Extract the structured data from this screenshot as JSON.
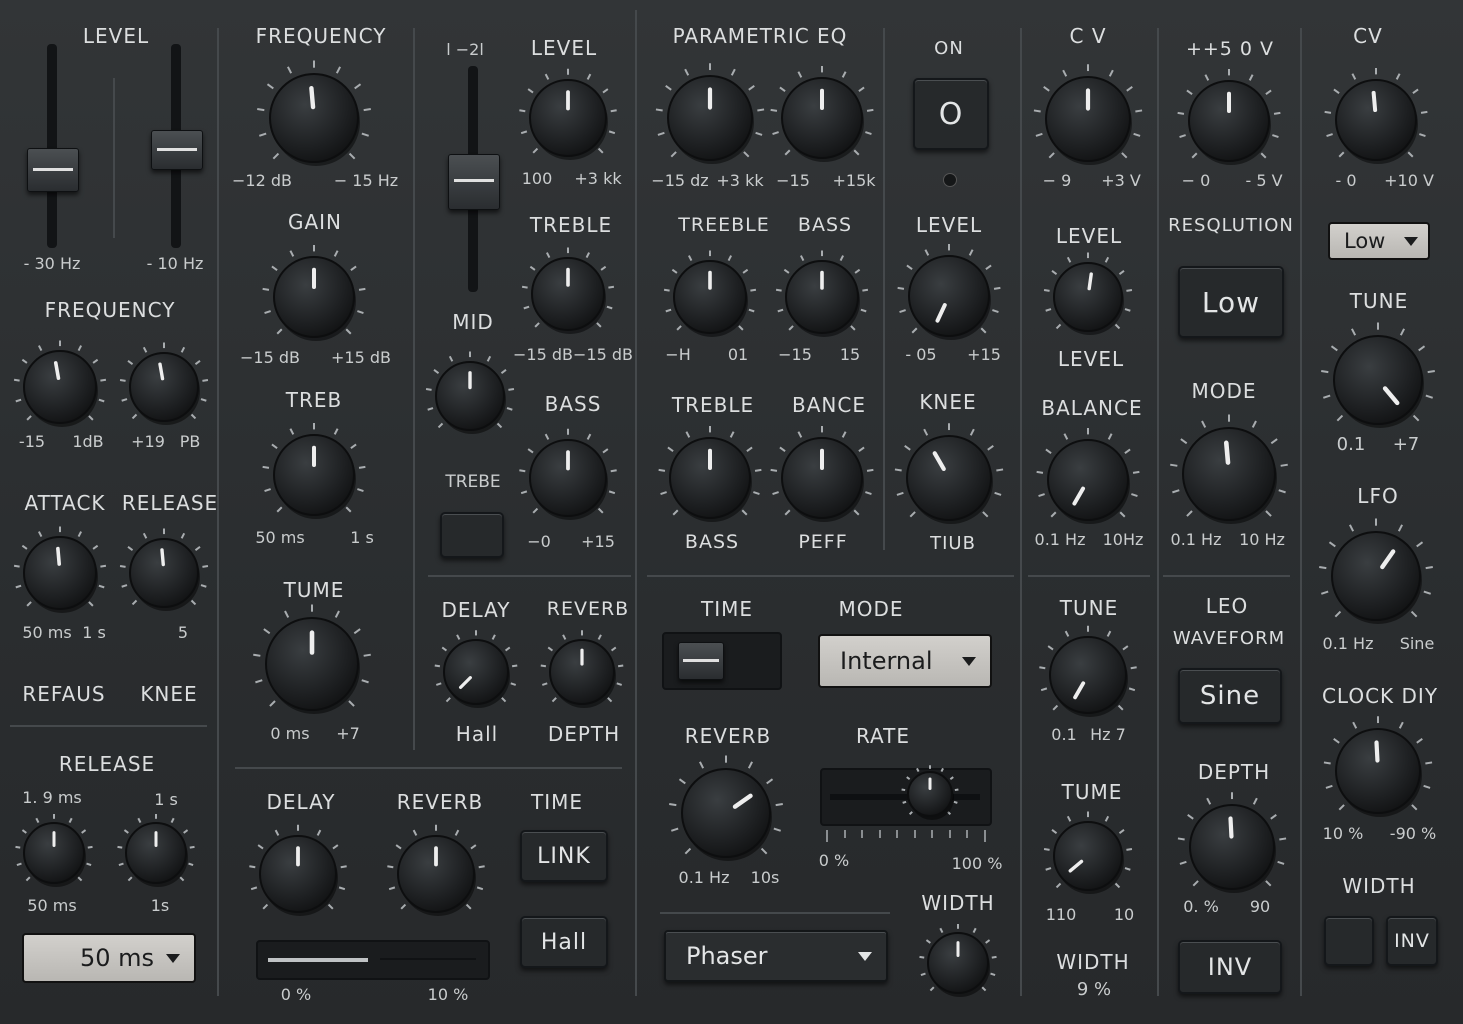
{
  "col1": {
    "level": "LEVEL",
    "slider_a_low": "- 30 Hz",
    "slider_b_low": "- 10 Hz",
    "frequency": "FREQUENCY",
    "freq_a_min": "-15",
    "freq_a_max": "1dB",
    "freq_b_min": "+19",
    "freq_b_max": "PB",
    "attack": "ATTACK",
    "release": "RELEASE",
    "attack_min": "50 ms",
    "attack_max": "1 s",
    "release_max": "5",
    "refaus": "REFAUS",
    "knee": "KNEE",
    "release2": "RELEASE",
    "rel_a_top": "1. 9 ms",
    "rel_a_bot": "50 ms",
    "rel_b_top": "1 s",
    "rel_b_bot": "1s",
    "dropdown_value": "50 ms"
  },
  "col2": {
    "frequency": "FREQUENCY",
    "freq_min": "−12 dB",
    "freq_max": "− 15 Hz",
    "gain": "GAIN",
    "gain_min": "−15 dB",
    "gain_max": "+15 dB",
    "treb": "TREB",
    "treb_min": "50 ms",
    "treb_max": "1 s",
    "tume": "TUME",
    "tume_min": "0 ms",
    "tume_max": "+7"
  },
  "col3": {
    "slider_top": "l −2l",
    "level": "LEVEL",
    "level_min": "100",
    "level_max": "+3 kk",
    "treble": "TREBLE",
    "treble_min": "−15 dB",
    "treble_max": "−15 dB",
    "mid": "MID",
    "bass": "BASS",
    "bass_min": "−0",
    "bass_max": "+15",
    "trebe": "TREBE",
    "delay": "DELAY",
    "delay_sub": "Hall",
    "reverb": "REVERB",
    "reverb_sub": "DEPTH"
  },
  "bottom_left": {
    "delay": "DELAY",
    "reverb": "REVERB",
    "time": "TIME",
    "link": "LINK",
    "hall": "Hall",
    "meter_min": "0 %",
    "meter_max": "10 %"
  },
  "eq": {
    "title": "PARAMETRIC EQ",
    "k1_min": "−15 dz",
    "k1_max": "+3 kk",
    "k2_min": "−15",
    "k2_max": "+15k",
    "treeble": "TREEBLE",
    "bass": "BASS",
    "treeble_min": "−H",
    "treeble_max": "01",
    "bass_min": "−15",
    "bass_max": "15",
    "treble": "TREBLE",
    "bance": "BANCE",
    "treble_sub": "BASS",
    "bance_sub": "PEFF"
  },
  "on_col": {
    "on": "ON",
    "button": "O",
    "level": "LEVEL",
    "level_min": "- 05",
    "level_max": "+15",
    "knee": "KNEE",
    "knee_sub": "TIUB"
  },
  "lower_mid": {
    "time": "TIME",
    "mode": "MODE",
    "mode_value": "Internal",
    "reverb": "REVERB",
    "reverb_min": "0.1 Hz",
    "reverb_max": "10s",
    "rate": "RATE",
    "rate_min": "0 %",
    "rate_max": "100 %",
    "effect_value": "Phaser",
    "width": "WIDTH"
  },
  "cv_col": {
    "cv": "C V",
    "cv_min": "− 9",
    "cv_max": "+3 V",
    "level": "LEVEL",
    "level_sub": "LEVEL",
    "balance": "BALANCE",
    "bal_min": "0.1 Hz",
    "bal_max": "10Hz",
    "tune": "TUNE",
    "tune_min": "0.1",
    "tune_max": "Hz 7",
    "tume": "TUME",
    "tume_min": "110",
    "tume_max": "10",
    "width": "WIDTH",
    "width_val": "9 %"
  },
  "res_col": {
    "voltage": "++5 0 V",
    "v_min": "− 0",
    "v_max": "- 5 V",
    "resolution": "RESQLUTION",
    "res_button": "Low",
    "mode": "MODE",
    "mode_min": "0.1 Hz",
    "mode_max": "10 Hz",
    "leo": "LEO",
    "waveform": "WAVEFORM",
    "wave_button": "Sine",
    "depth": "DEPTH",
    "depth_min": "0. %",
    "depth_max": "90",
    "inv": "INV"
  },
  "right_col": {
    "cv": "CV",
    "cv_min": "- 0",
    "cv_max": "+10 V",
    "dropdown_value": "Low",
    "tune": "TUNE",
    "tune_min": "0.1",
    "tune_max": "+7",
    "lfo": "LFO",
    "lfo_min": "0.1 Hz",
    "lfo_max": "Sine",
    "clock": "CLOCK DIY",
    "clock_min": "10 %",
    "clock_max": "‑90 %",
    "width": "WIDTH",
    "inv": "INV"
  }
}
